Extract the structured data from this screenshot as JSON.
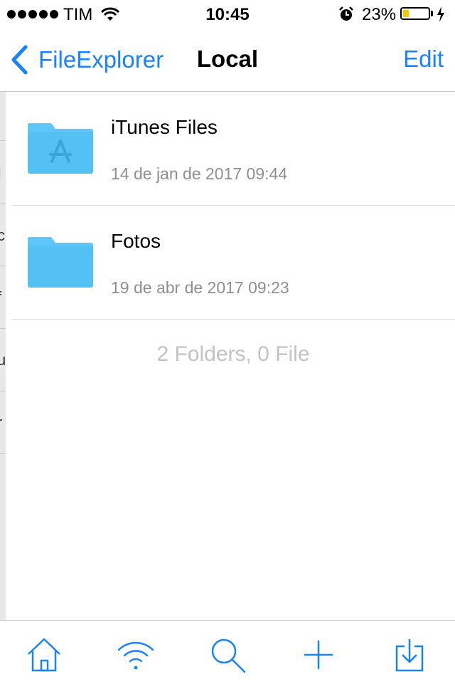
{
  "status_bar": {
    "carrier": "TIM",
    "time": "10:45",
    "battery_percent": "23%",
    "battery_level": 0.23,
    "battery_color": "#f7c600"
  },
  "nav": {
    "back_label": "FileExplorer",
    "title": "Local",
    "edit_label": "Edit"
  },
  "files": [
    {
      "name": "iTunes Files",
      "date": "14 de jan de 2017 09:44",
      "icon": "app-store-folder-icon"
    },
    {
      "name": "Fotos",
      "date": "19 de abr de 2017 09:23",
      "icon": "folder-icon"
    }
  ],
  "summary": "2 Folders, 0 File",
  "tab_bar": [
    {
      "icon": "home-icon"
    },
    {
      "icon": "wifi-icon"
    },
    {
      "icon": "search-icon"
    },
    {
      "icon": "plus-icon"
    },
    {
      "icon": "download-icon"
    }
  ],
  "colors": {
    "accent": "#1a82fb",
    "folder": "#54c1f5",
    "folder_tab": "#5ec6f8"
  }
}
